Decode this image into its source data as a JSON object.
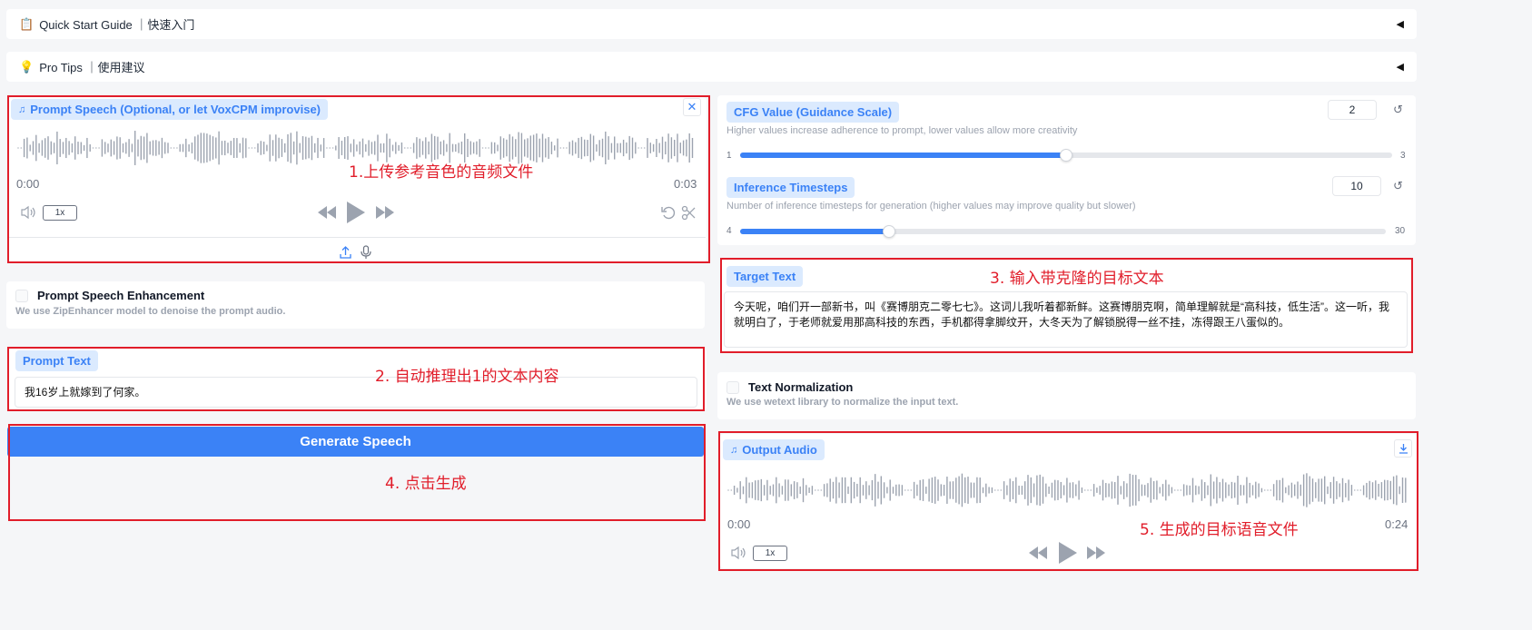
{
  "accordions": {
    "quick_start": {
      "icon": "clipboard-icon",
      "label": "Quick Start Guide ｜快速入门",
      "toggle": "◀"
    },
    "pro_tips": {
      "icon": "lightbulb-icon",
      "label": "Pro Tips ｜使用建议",
      "toggle": "◀"
    }
  },
  "prompt_speech": {
    "label": "Prompt Speech (Optional, or let VoxCPM improvise)",
    "icon": "music-note-icon",
    "time_start": "0:00",
    "time_end": "0:03",
    "speed": "1x",
    "close_icon": "close-icon"
  },
  "enhancement": {
    "label": "Prompt Speech Enhancement",
    "description": "We use ZipEnhancer model to denoise the prompt audio."
  },
  "prompt_text": {
    "label": "Prompt Text",
    "value": "我16岁上就嫁到了何家。"
  },
  "generate_button": {
    "label": "Generate Speech"
  },
  "cfg": {
    "label": "CFG Value (Guidance Scale)",
    "description": "Higher values increase adherence to prompt, lower values allow more creativity",
    "value": "2",
    "min": "1",
    "max": "3",
    "fraction": 0.5
  },
  "timesteps": {
    "label": "Inference Timesteps",
    "description": "Number of inference timesteps for generation (higher values may improve quality but slower)",
    "value": "10",
    "min": "4",
    "max": "30",
    "fraction": 0.2308
  },
  "target_text": {
    "label": "Target Text",
    "value": "今天呢，咱们开一部新书，叫《赛博朋克二零七七》。这词儿我听着都新鲜。这赛博朋克啊，简单理解就是“高科技，低生活”。这一听，我就明白了，于老师就爱用那高科技的东西，手机都得拿脚纹开，大冬天为了解锁脱得一丝不挂，冻得跟王八蛋似的。"
  },
  "normalization": {
    "label": "Text Normalization",
    "description": "We use wetext library to normalize the input text."
  },
  "output_audio": {
    "label": "Output Audio",
    "icon": "music-note-icon",
    "time_start": "0:00",
    "time_end": "0:24",
    "speed": "1x"
  },
  "annotations": {
    "a1": "1.上传参考音色的音频文件",
    "a2": "2. 自动推理出1的文本内容",
    "a3": "3. 输入带克隆的目标文本",
    "a4": "4. 点击生成",
    "a5": "5. 生成的目标语音文件"
  },
  "colors": {
    "accent": "#3b82f6",
    "annotation": "#e11d2a",
    "tag_bg": "#dbeafe"
  }
}
